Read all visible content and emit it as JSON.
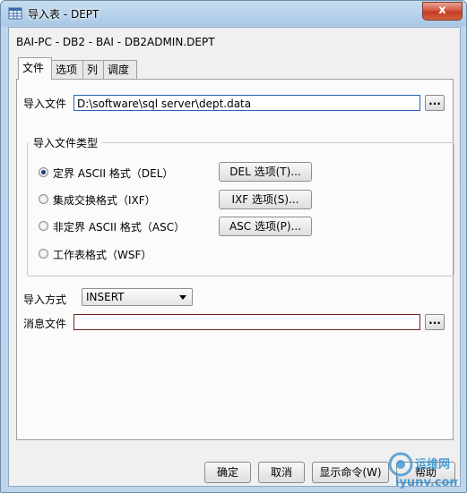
{
  "window": {
    "title": "导入表 - DEPT",
    "close_label": "x"
  },
  "header": {
    "subtitle": "BAI-PC - DB2 - BAI - DB2ADMIN.DEPT"
  },
  "tabs": [
    {
      "label": "文件"
    },
    {
      "label": "选项"
    },
    {
      "label": "列"
    },
    {
      "label": "调度"
    }
  ],
  "import_file": {
    "label": "导入文件",
    "value": "D:\\software\\sql server\\dept.data",
    "browse_label": "..."
  },
  "file_type": {
    "group_label": "导入文件类型",
    "options": [
      {
        "label": "定界 ASCII 格式（DEL）",
        "button": "DEL 选项(T)...",
        "checked": true
      },
      {
        "label": "集成交换格式（IXF）",
        "button": "IXF 选项(S)...",
        "checked": false
      },
      {
        "label": "非定界 ASCII 格式（ASC）",
        "button": "ASC 选项(P)...",
        "checked": false
      },
      {
        "label": "工作表格式（WSF）",
        "button": "",
        "checked": false
      }
    ]
  },
  "import_mode": {
    "label": "导入方式",
    "value": "INSERT"
  },
  "message_file": {
    "label": "消息文件",
    "value": "",
    "browse_label": "..."
  },
  "buttons": {
    "ok": "确定",
    "cancel": "取消",
    "show_command": "显示命令(W)",
    "help": "帮助"
  },
  "watermark": {
    "text_cn": "运维网",
    "text_url": "iyunv.com"
  },
  "colors": {
    "title_gradient_top": "#c6dcef",
    "close_red": "#c13b25",
    "focus_blue": "#2d63b5",
    "message_border": "#7a2020"
  }
}
